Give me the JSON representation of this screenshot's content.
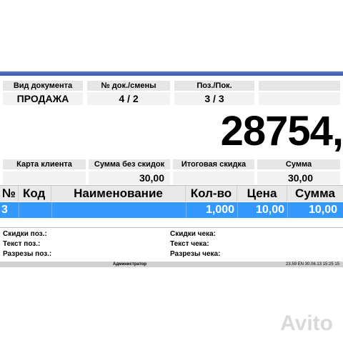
{
  "header_labels": [
    "Вид документа",
    "№ док./смены",
    "Поз./Пок."
  ],
  "header_values": [
    "ПРОДАЖА",
    "4 / 2",
    "3 / 3"
  ],
  "total_big": "28754,",
  "mid_labels": [
    "Карта клиента",
    "Сумма без скидок",
    "Итоговая скидка",
    "Сумма"
  ],
  "mid_values": [
    "",
    "30,00",
    "",
    "30,00"
  ],
  "table": {
    "columns": [
      "№",
      "Код",
      "Наименование",
      "Кол-во",
      "Цена",
      "Сумма"
    ],
    "rows": [
      [
        "3",
        "",
        "",
        "1,000",
        "10,00",
        "10,00"
      ]
    ]
  },
  "info_left": [
    "Скидки поз.:",
    "Текст поз.:",
    "Разрезы поз.:"
  ],
  "info_right": [
    "Скидки чека:",
    "Текст чека:",
    "Разрезы чека:"
  ],
  "status": {
    "user": "Администратор",
    "right": "23.59  EN  30.06.13  15:25 15"
  },
  "watermark": "Avito",
  "colors": {
    "selected_row": "#3399ff",
    "title_bar": "#3a58b0"
  }
}
